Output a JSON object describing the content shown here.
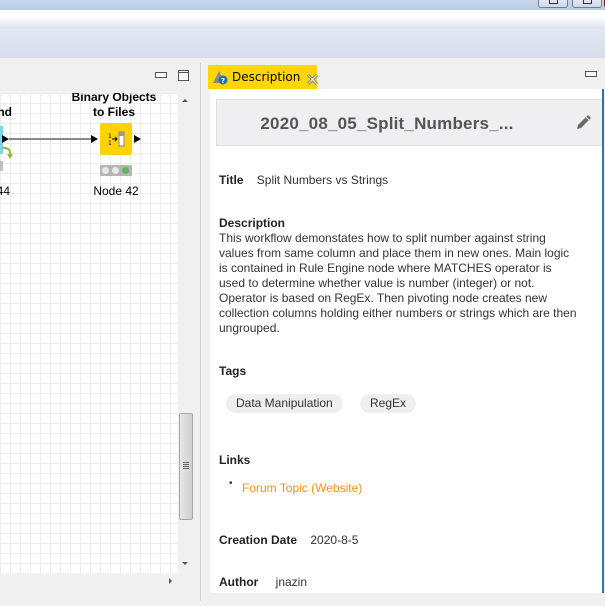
{
  "window": {
    "controls": [
      "maximize",
      "restore",
      "close"
    ]
  },
  "editor": {
    "nodes": [
      {
        "label_lines": [
          "",
          "nd"
        ],
        "sub": "44",
        "partial": true
      },
      {
        "label_lines": [
          "Binary Objects",
          "to Files"
        ],
        "sub": "Node 42",
        "status": "green"
      }
    ]
  },
  "description_panel": {
    "tab_label": "Description",
    "header_title": "2020_08_05_Split_Numbers_...",
    "title_label": "Title",
    "title_value": "Split Numbers vs Strings",
    "description_label": "Description",
    "description_text": "This workflow demonstates how to split number against string values from same column and place them in new ones. Main logic is contained in Rule Engine node where MATCHES operator is used to determine whether value is number (integer) or not. Operator is based on RegEx. Then pivoting node creates new collection columns holding either numbers or strings which are then ungrouped.",
    "tags_label": "Tags",
    "tags": [
      "Data Manipulation",
      "RegEx"
    ],
    "links_label": "Links",
    "links": [
      {
        "text": "Forum Topic (Website)"
      }
    ],
    "creation_date_label": "Creation Date",
    "creation_date_value": "2020-8-5",
    "author_label": "Author",
    "author_value": "jnazin"
  },
  "colors": {
    "tab_active": "#ffd700",
    "node_fill": "#ffd200",
    "link": "#f39016",
    "status_green": "#5cb85c"
  }
}
